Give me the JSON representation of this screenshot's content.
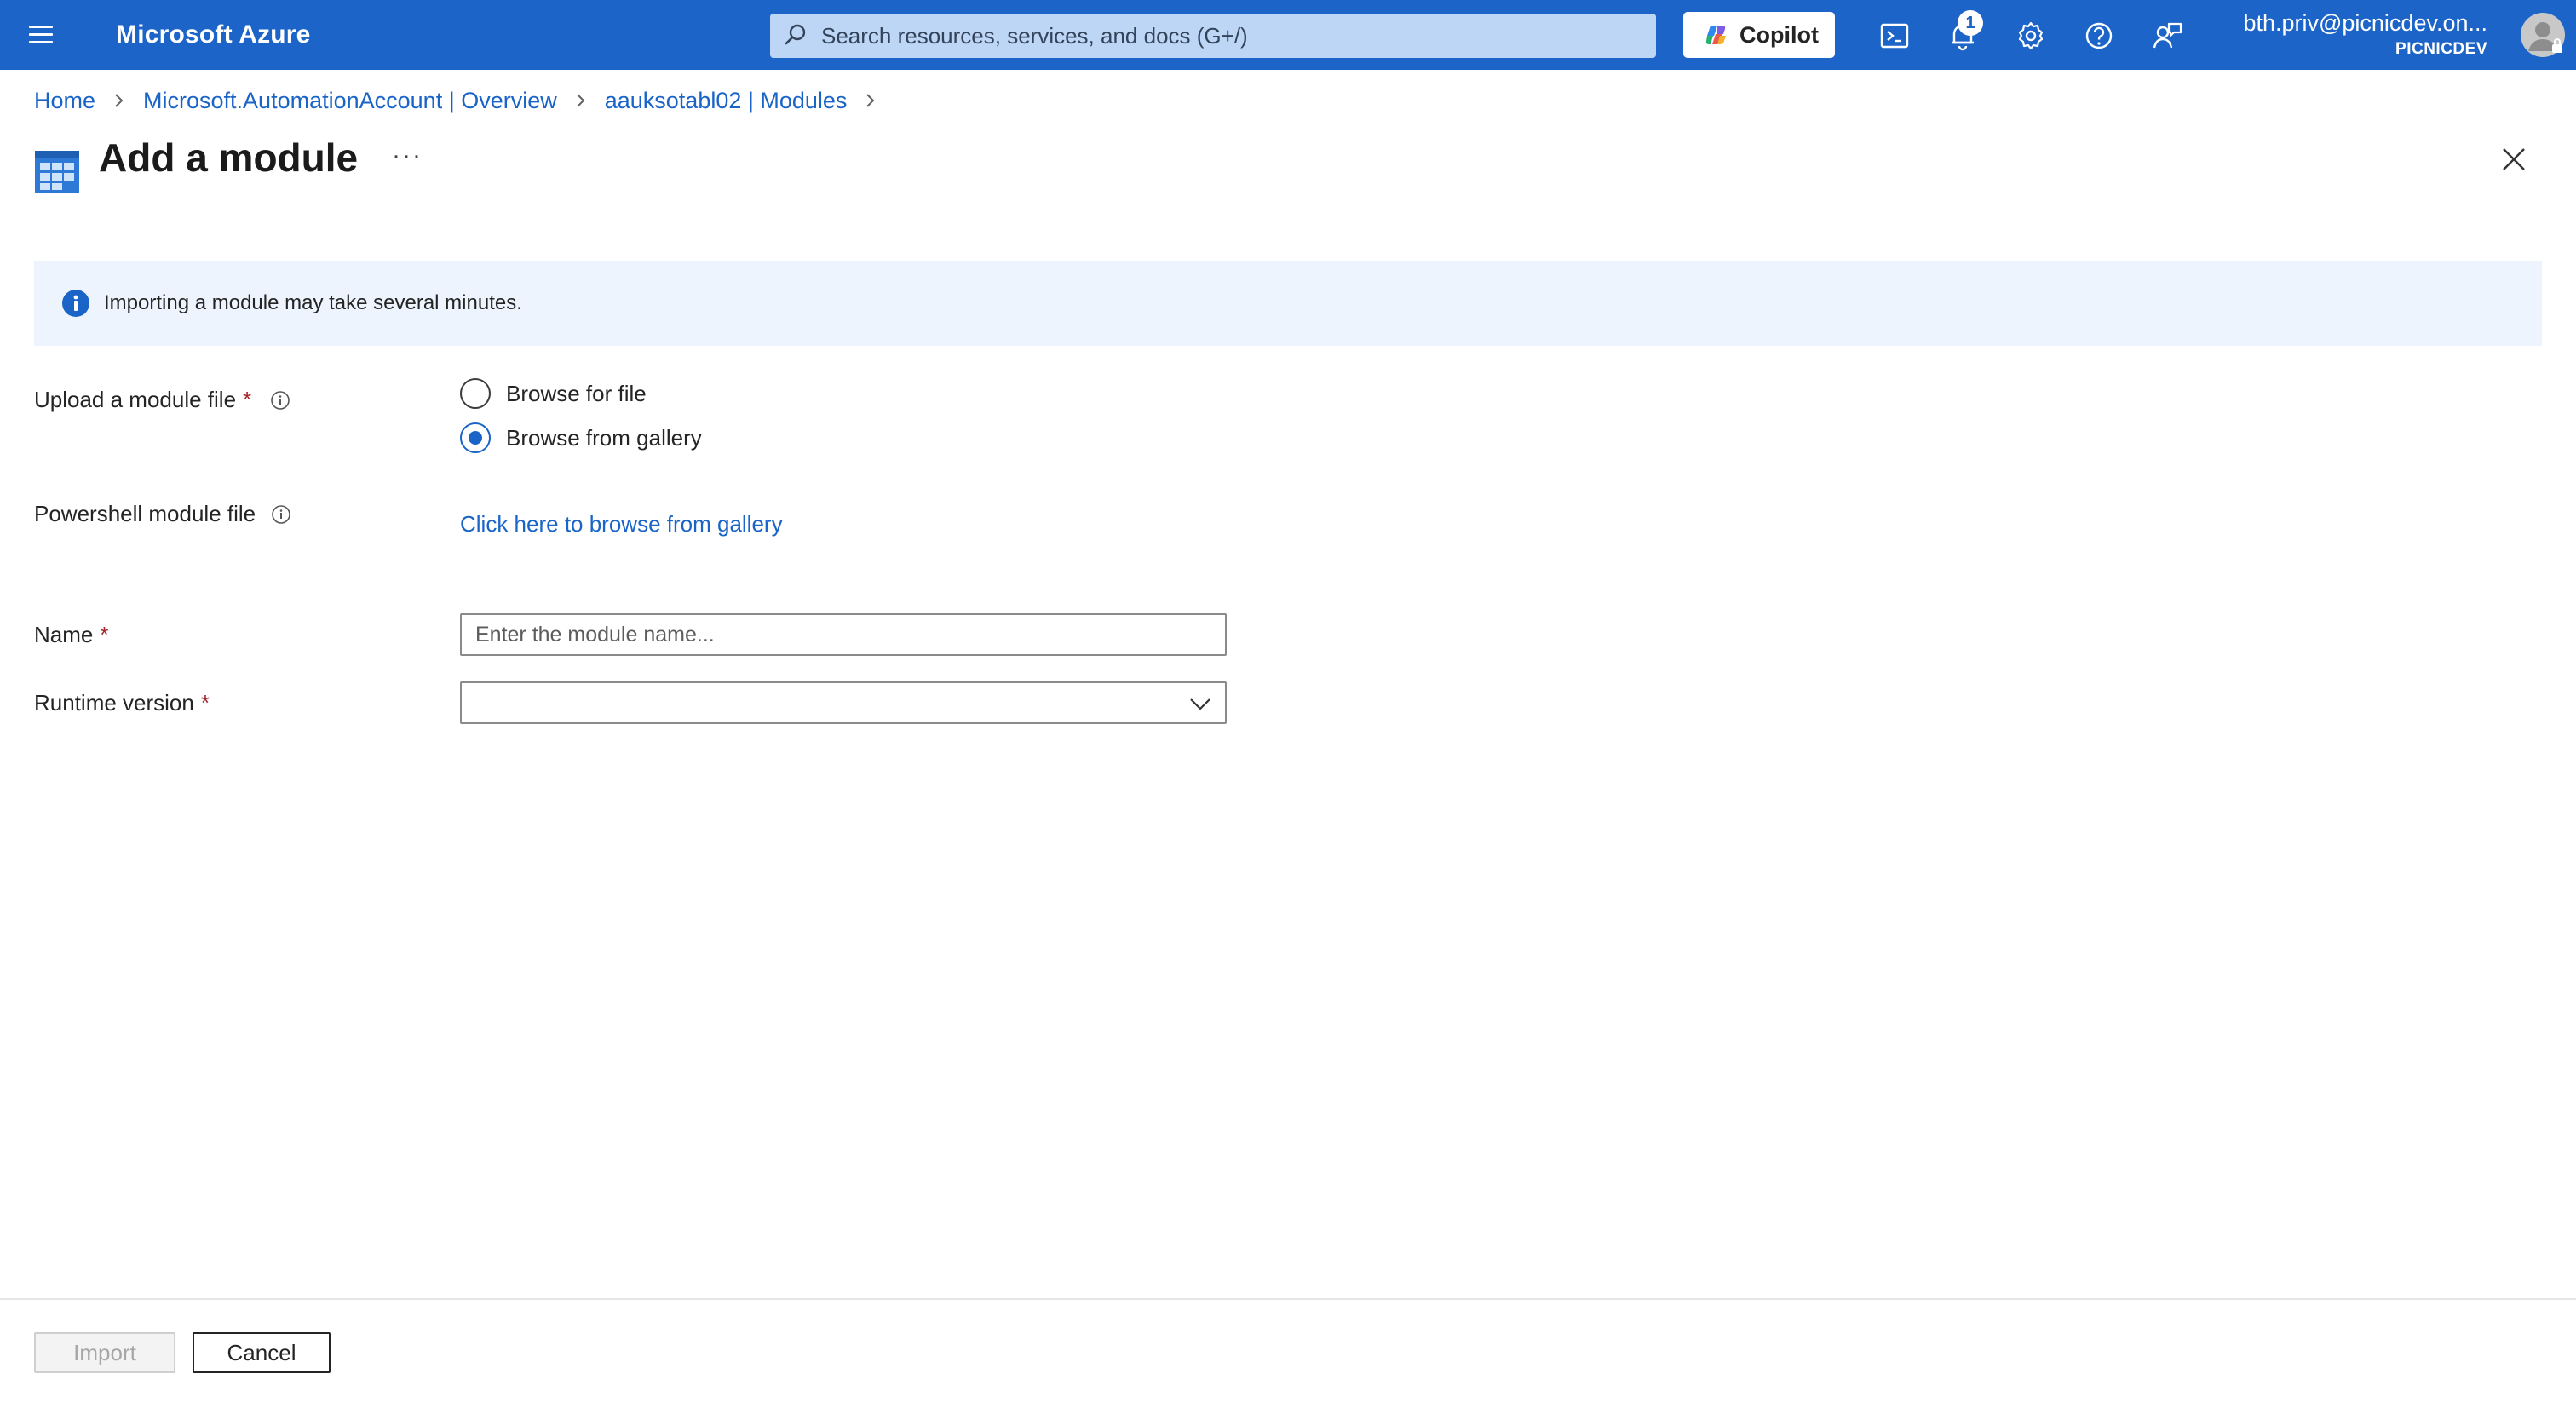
{
  "header": {
    "brand": "Microsoft Azure",
    "search_placeholder": "Search resources, services, and docs (G+/)",
    "copilot_label": "Copilot",
    "notification_count": "1",
    "account_email": "bth.priv@picnicdev.on...",
    "account_tenant": "PICNICDEV",
    "icons": [
      "menu-icon",
      "search-icon",
      "copilot-icon",
      "cloud-shell-icon",
      "bell-icon",
      "gear-icon",
      "help-icon",
      "feedback-icon",
      "avatar-icon"
    ]
  },
  "breadcrumb": {
    "items": [
      "Home",
      "Microsoft.AutomationAccount | Overview",
      "aauksotabl02 | Modules"
    ]
  },
  "page": {
    "title": "Add a module",
    "more_label": "···"
  },
  "banner": {
    "text": "Importing a module may take several minutes."
  },
  "form": {
    "upload_label": "Upload a module file",
    "required_mark": "*",
    "upload_options": [
      {
        "label": "Browse for file",
        "selected": false
      },
      {
        "label": "Browse from gallery",
        "selected": true
      }
    ],
    "ps_file_label": "Powershell module file",
    "gallery_link": "Click here to browse from gallery",
    "name_label": "Name",
    "name_placeholder": "Enter the module name...",
    "name_value": "",
    "runtime_label": "Runtime version",
    "runtime_value": ""
  },
  "footer": {
    "import_label": "Import",
    "cancel_label": "Cancel"
  },
  "colors": {
    "topbar": "#1c64c8",
    "accent": "#1a64c8",
    "banner_bg": "#eef4fe",
    "required": "#a4262c"
  }
}
